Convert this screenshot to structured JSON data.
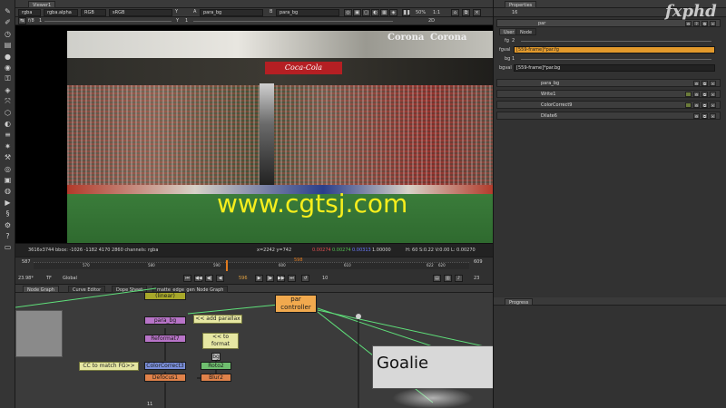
{
  "toolbar": {
    "icons": [
      "pointer-icon",
      "paint-icon",
      "time-icon",
      "channel-icon",
      "color-icon",
      "filter-icon",
      "keyer-icon",
      "merge-icon",
      "transform-icon",
      "3d-icon",
      "views-icon",
      "metadata-icon",
      "particles-icon",
      "toolsets-icon",
      "other-icon",
      "furnace-icon",
      "ocula-icon",
      "render-icon",
      "python-icon",
      "gear-icon",
      "help-icon",
      "file-icon"
    ]
  },
  "viewer": {
    "tab": "Viewer1",
    "channels": "rgba",
    "alpha": "rgba.alpha",
    "colorspace": "RGB",
    "lut": "sRGB",
    "input_a_label": "A",
    "input_a": "para_bg",
    "input_b_label": "B",
    "input_b": "para_bg",
    "zoom": "50%",
    "ratio": "1:1",
    "view_mode": "2D",
    "gain_label": "f/8",
    "gain_value": "1",
    "gamma_label": "Y",
    "gamma_value": "1",
    "image_banner_1": "Corona",
    "image_banner_2": "Corona",
    "image_sign": "Coca-Cola",
    "info_format": "3616x3744  bbox: -1026 -1182 4170 2860 channels: rgba",
    "info_coords": "x=2242 y=742",
    "info_r": "0.00274",
    "info_g": "0.00274",
    "info_b": "0.00313",
    "info_a": "1.00000",
    "info_hsv": "H: 60 S:0.22 V:0.00  L: 0.00270",
    "timeline": {
      "start": "587",
      "end": "609",
      "ticks": [
        "570",
        "580",
        "590",
        "600",
        "610",
        "620",
        "622"
      ],
      "marker": "598",
      "fps": "23.98*",
      "tf": "TF",
      "global": "Global",
      "current_frame": "596",
      "step": "10",
      "right_value": "23"
    }
  },
  "watermark": "www.cgtsj.com",
  "brand": "fxphd",
  "properties": {
    "title": "Properties",
    "count": "16",
    "node_name": "par",
    "tabs": [
      "User",
      "Node"
    ],
    "knobs": [
      {
        "label": "fg",
        "value": "2"
      },
      {
        "label": "fgval",
        "value": "[559-frame]*par.fg"
      },
      {
        "label": "bg",
        "value": "1"
      },
      {
        "label": "bgval",
        "value": "[559-frame]*par.bg"
      }
    ],
    "nodes": [
      "para_bg",
      "Write1",
      "ColorCorrect9",
      "Dilate6"
    ]
  },
  "nodegraph": {
    "tabs": [
      "Node Graph",
      "Curve Editor",
      "Dope Sheet",
      "matte_edge_gen Node Graph"
    ],
    "nodes": {
      "linear": "(linear)",
      "para_bg": "para_bg",
      "reformat": "Reformat7",
      "colorcorrect": "ColorCorrect3",
      "defocus": "Defocus1",
      "roto": "Roto2",
      "blur": "Blur2",
      "bg": "bg",
      "par_controller": "par\ncontroller",
      "goalie": "Goalie",
      "eleven": "11"
    },
    "notes": {
      "parallax": "<< add parallax",
      "format": "<< to format",
      "match": "CC to match FG>>"
    }
  },
  "progress": {
    "title": "Progress"
  }
}
